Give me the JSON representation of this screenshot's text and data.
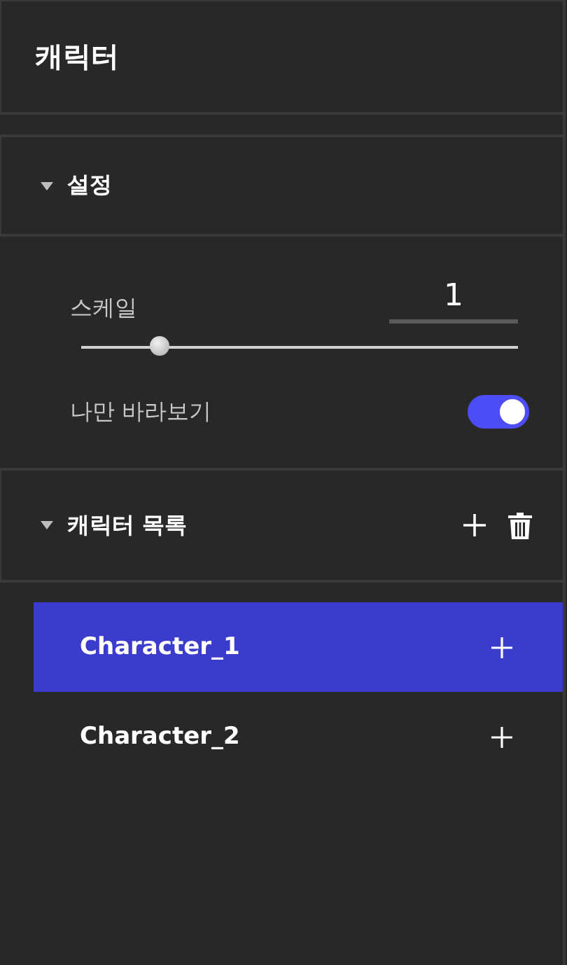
{
  "title": "캐릭터",
  "settings": {
    "title": "설정",
    "expanded": true,
    "scale_label": "스케일",
    "scale_value": "1",
    "slider": {
      "level": 0.18
    },
    "look_at_me": {
      "label": "나만 바라보기",
      "on": true
    }
  },
  "character_list": {
    "title": "캐릭터 목록",
    "expanded": true,
    "items": [
      {
        "name": "Character_1",
        "selected": true
      },
      {
        "name": "Character_2",
        "selected": false
      }
    ]
  }
}
